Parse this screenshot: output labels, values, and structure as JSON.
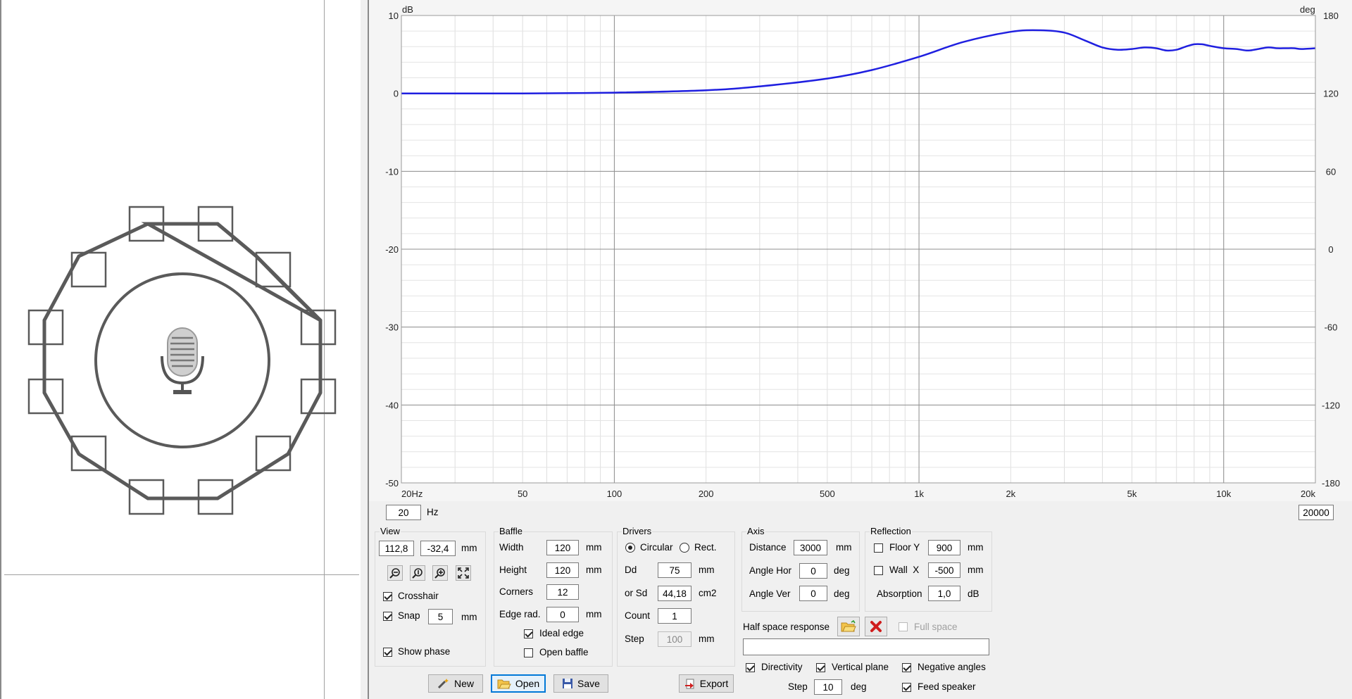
{
  "graph": {
    "left_unit": "dB",
    "right_unit": "deg",
    "y_ticks": [
      {
        "v": 10,
        "label": "10"
      },
      {
        "v": 0,
        "label": "0"
      },
      {
        "v": -10,
        "label": "-10"
      },
      {
        "v": -20,
        "label": "-20"
      },
      {
        "v": -30,
        "label": "-30"
      },
      {
        "v": -40,
        "label": "-40"
      },
      {
        "v": -50,
        "label": "-50"
      }
    ],
    "right_ticks": [
      {
        "v": 10,
        "label": "180"
      },
      {
        "v": 0,
        "label": "120"
      },
      {
        "v": -10,
        "label": "60"
      },
      {
        "v": -20,
        "label": "0"
      },
      {
        "v": -30,
        "label": "-60"
      },
      {
        "v": -40,
        "label": "-120"
      },
      {
        "v": -50,
        "label": "-180"
      }
    ],
    "x_ticks": [
      {
        "f": 20,
        "label": "20Hz"
      },
      {
        "f": 50,
        "label": "50"
      },
      {
        "f": 100,
        "label": "100"
      },
      {
        "f": 200,
        "label": "200"
      },
      {
        "f": 500,
        "label": "500"
      },
      {
        "f": 1000,
        "label": "1k"
      },
      {
        "f": 2000,
        "label": "2k"
      },
      {
        "f": 5000,
        "label": "5k"
      },
      {
        "f": 10000,
        "label": "10k"
      },
      {
        "f": 20000,
        "label": "20k"
      }
    ],
    "line_color": "#1f1fe0"
  },
  "chart_data": {
    "type": "line",
    "xlabel": "",
    "ylabel": "dB",
    "x_scale": "log",
    "xlim": [
      20,
      20000
    ],
    "ylim": [
      -50,
      10
    ],
    "series": [
      {
        "x": [
          20,
          50,
          100,
          200,
          300,
          500,
          700,
          1000,
          1400,
          2000,
          2500,
          3000,
          3500,
          4000,
          4500,
          5000,
          5500,
          6000,
          6500,
          7000,
          7500,
          8000,
          8500,
          9000,
          10000,
          11000,
          12000,
          13000,
          14000,
          15000,
          16000,
          17000,
          18000,
          20000
        ],
        "values": [
          0,
          0,
          0.1,
          0.4,
          0.9,
          1.9,
          3.0,
          4.7,
          6.6,
          7.9,
          8.1,
          7.8,
          6.8,
          5.9,
          5.6,
          5.7,
          5.9,
          5.8,
          5.5,
          5.6,
          6.0,
          6.3,
          6.3,
          6.1,
          5.8,
          5.7,
          5.5,
          5.7,
          5.9,
          5.8,
          5.8,
          5.8,
          5.7,
          5.8
        ]
      }
    ]
  },
  "freq_min": "20",
  "freq_unit": "Hz",
  "freq_max": "20000",
  "view": {
    "title": "View",
    "x": "112,8",
    "y": "-32,4",
    "unit": "mm",
    "crosshair": "Crosshair",
    "snap": "Snap",
    "snap_value": "5",
    "snap_unit": "mm",
    "show_phase": "Show phase"
  },
  "baffle": {
    "title": "Baffle",
    "width_label": "Width",
    "width": "120",
    "width_unit": "mm",
    "height_label": "Height",
    "height": "120",
    "height_unit": "mm",
    "corners_label": "Corners",
    "corners": "12",
    "edge_label": "Edge rad.",
    "edge": "0",
    "edge_unit": "mm",
    "ideal_edge": "Ideal edge",
    "open_baffle": "Open baffle"
  },
  "drivers": {
    "title": "Drivers",
    "circular": "Circular",
    "rect": "Rect.",
    "dd_label": "Dd",
    "dd": "75",
    "dd_unit": "mm",
    "sd_label": "or Sd",
    "sd": "44,18",
    "sd_unit": "cm2",
    "count_label": "Count",
    "count": "1",
    "step_label": "Step",
    "step": "100",
    "step_unit": "mm"
  },
  "axis": {
    "title": "Axis",
    "distance_label": "Distance",
    "distance": "3000",
    "distance_unit": "mm",
    "hor_label": "Angle Hor",
    "hor": "0",
    "hor_unit": "deg",
    "ver_label": "Angle Ver",
    "ver": "0",
    "ver_unit": "deg"
  },
  "reflection": {
    "title": "Reflection",
    "floor_label": "Floor Y",
    "floor": "900",
    "floor_unit": "mm",
    "wall_label": "Wall  X",
    "wall": "-500",
    "wall_unit": "mm",
    "abs_label": "Absorption",
    "abs": "1,0",
    "abs_unit": "dB"
  },
  "half_space": {
    "label": "Half space response",
    "full_space": "Full space",
    "path": ""
  },
  "options": {
    "directivity": "Directivity",
    "vertical_plane": "Vertical plane",
    "negative_angles": "Negative angles",
    "step_label": "Step",
    "step": "10",
    "step_unit": "deg",
    "feed_speaker": "Feed speaker"
  },
  "buttons": {
    "new": "New",
    "open": "Open",
    "save": "Save",
    "export": "Export"
  }
}
